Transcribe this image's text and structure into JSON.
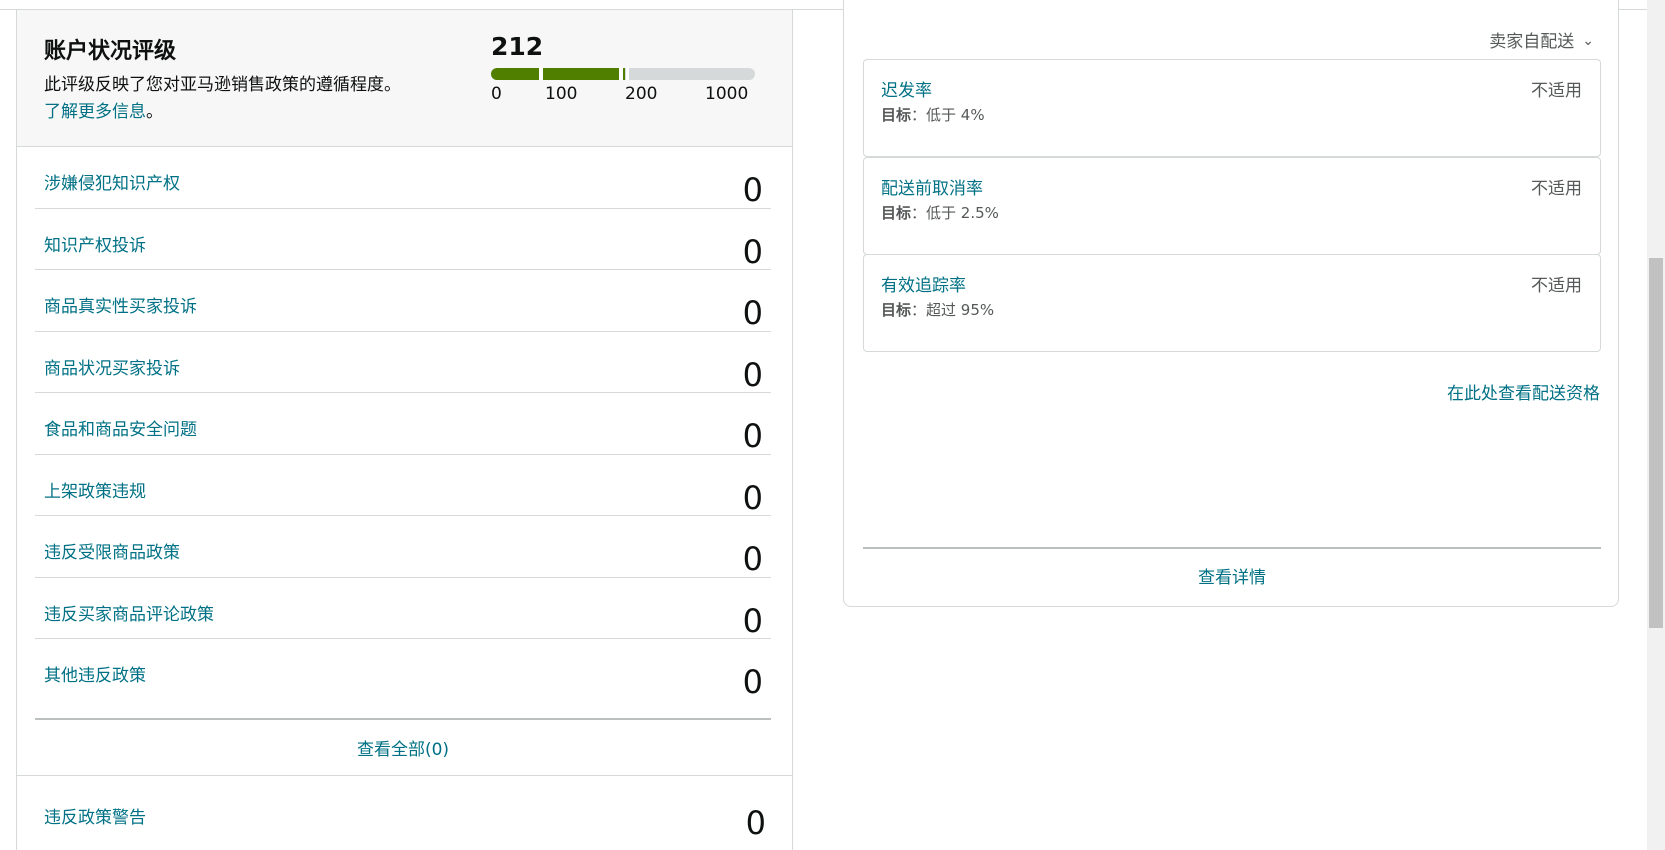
{
  "account_health": {
    "title": "账户状况评级",
    "description": "此评级反映了您对亚马逊销售政策的遵循程度。",
    "learn_more": "了解更多信息",
    "learn_more_suffix": "。",
    "score": "212",
    "score_value": 212,
    "gauge_ticks": [
      "0",
      "100",
      "200",
      "1000"
    ],
    "gauge_colors": {
      "fill": "#507f00",
      "track": "#d5d9d9"
    }
  },
  "violations": [
    {
      "label": "涉嫌侵犯知识产权",
      "count": "0"
    },
    {
      "label": "知识产权投诉",
      "count": "0"
    },
    {
      "label": "商品真实性买家投诉",
      "count": "0"
    },
    {
      "label": "商品状况买家投诉",
      "count": "0"
    },
    {
      "label": "食品和商品安全问题",
      "count": "0"
    },
    {
      "label": "上架政策违规",
      "count": "0"
    },
    {
      "label": "违反受限商品政策",
      "count": "0"
    },
    {
      "label": "违反买家商品评论政策",
      "count": "0"
    },
    {
      "label": "其他违反政策",
      "count": "0"
    }
  ],
  "view_all": "查看全部(0)",
  "policy_warnings": {
    "label": "违反政策警告",
    "count": "0"
  },
  "shipping": {
    "fulfillment_select": "卖家自配送",
    "metrics": [
      {
        "name": "迟发率",
        "target_label": "目标",
        "target_value": "：低于 4%",
        "status": "不适用"
      },
      {
        "name": "配送前取消率",
        "target_label": "目标",
        "target_value": "：低于 2.5%",
        "status": "不适用"
      },
      {
        "name": "有效追踪率",
        "target_label": "目标",
        "target_value": "：超过 95%",
        "status": "不适用"
      }
    ],
    "eligibility_link": "在此处查看配送资格",
    "view_details": "查看详情"
  },
  "colors": {
    "link": "#007185",
    "text": "#0f1111",
    "muted": "#565959",
    "border": "#d5d9d9"
  }
}
